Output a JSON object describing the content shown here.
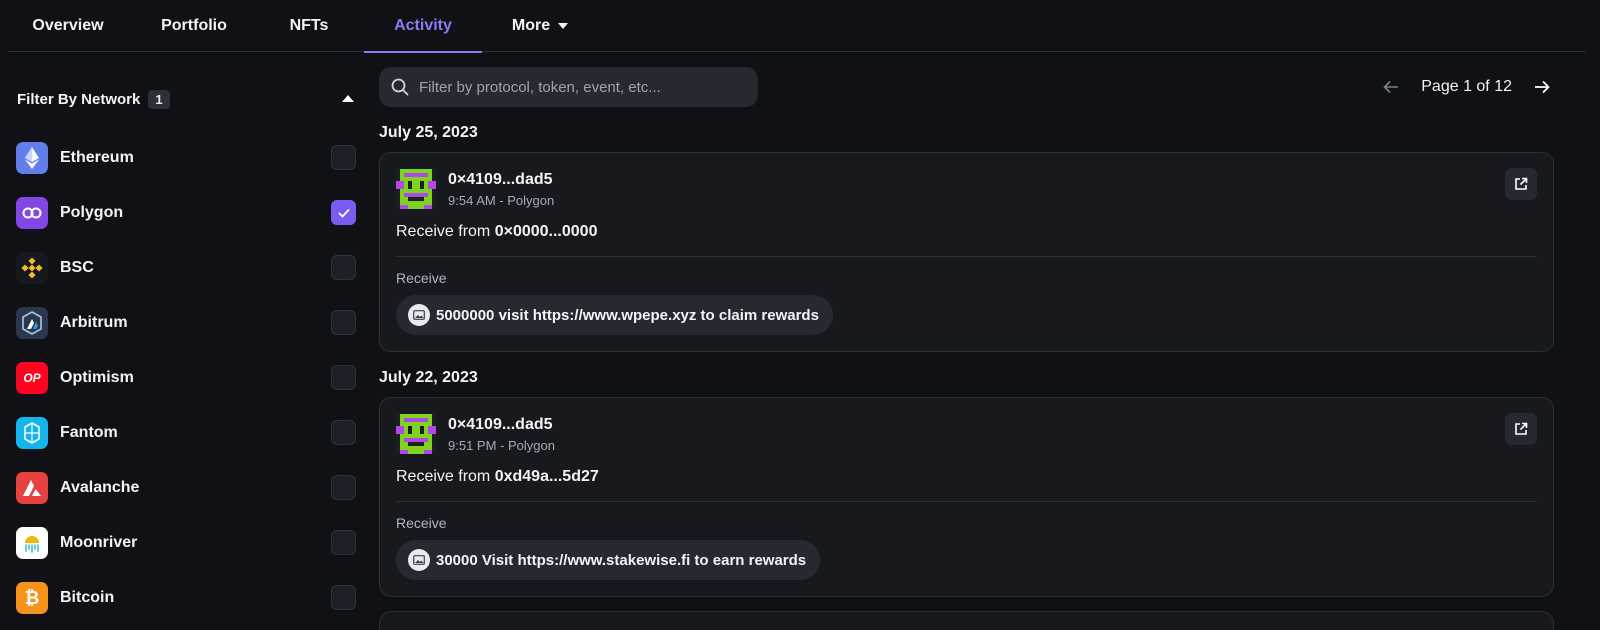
{
  "tabs": [
    {
      "label": "Overview"
    },
    {
      "label": "Portfolio"
    },
    {
      "label": "NFTs"
    },
    {
      "label": "Activity"
    },
    {
      "label": "More"
    }
  ],
  "active_tab": "Activity",
  "accent_color": "#8b7cf6",
  "filter": {
    "title": "Filter By Network",
    "count": "1",
    "networks": [
      {
        "label": "Ethereum",
        "checked": false,
        "icon": "ethereum-icon",
        "color": "#627eea"
      },
      {
        "label": "Polygon",
        "checked": true,
        "icon": "polygon-icon",
        "color": "#8247e5"
      },
      {
        "label": "BSC",
        "checked": false,
        "icon": "bsc-icon",
        "color": "#f3ba2f"
      },
      {
        "label": "Arbitrum",
        "checked": false,
        "icon": "arbitrum-icon",
        "color": "#2d374b"
      },
      {
        "label": "Optimism",
        "checked": false,
        "icon": "optimism-icon",
        "color": "#ff0420"
      },
      {
        "label": "Fantom",
        "checked": false,
        "icon": "fantom-icon",
        "color": "#1969ff"
      },
      {
        "label": "Avalanche",
        "checked": false,
        "icon": "avalanche-icon",
        "color": "#e84142"
      },
      {
        "label": "Moonriver",
        "checked": false,
        "icon": "moonriver-icon",
        "color": "#f2b705"
      },
      {
        "label": "Bitcoin",
        "checked": false,
        "icon": "bitcoin-icon",
        "color": "#f7931a"
      }
    ]
  },
  "search": {
    "placeholder": "Filter by protocol, token, event, etc...",
    "value": ""
  },
  "pagination": {
    "text": "Page 1 of 12"
  },
  "activity": [
    {
      "date": "July 25, 2023",
      "address": "0×4109...dad5",
      "meta": "9:54 AM - Polygon",
      "desc_prefix": "Receive from",
      "desc_from": "0×0000...0000",
      "section": "Receive",
      "token": "5000000 visit https://www.wpepe.xyz to claim rewards"
    },
    {
      "date": "July 22, 2023",
      "address": "0×4109...dad5",
      "meta": "9:51 PM - Polygon",
      "desc_prefix": "Receive from",
      "desc_from": "0xd49a...5d27",
      "section": "Receive",
      "token": "30000 Visit https://www.stakewise.fi to earn rewards"
    }
  ]
}
